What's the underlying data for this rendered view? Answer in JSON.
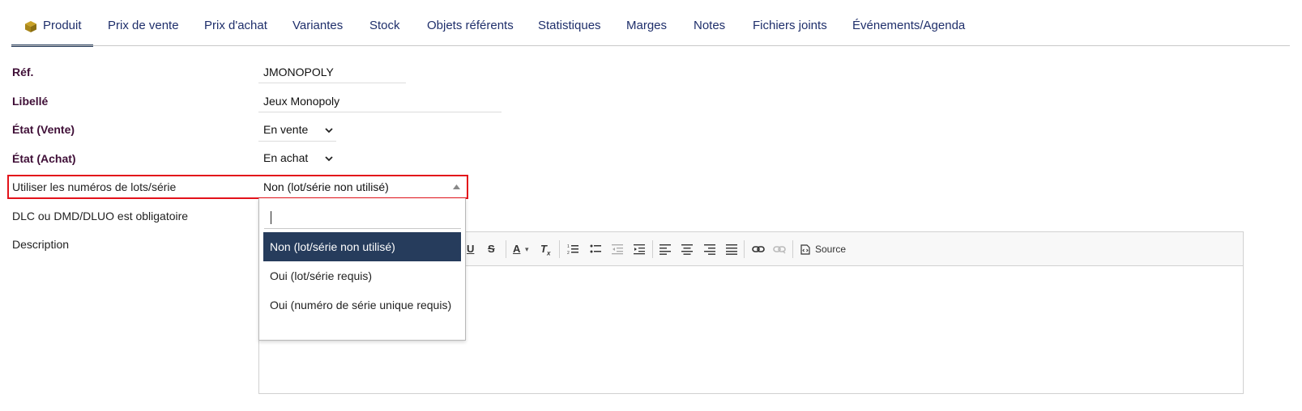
{
  "tabs": [
    {
      "label": "Produit",
      "icon": "box-icon",
      "active": true
    },
    {
      "label": "Prix de vente"
    },
    {
      "label": "Prix d'achat"
    },
    {
      "label": "Variantes"
    },
    {
      "label": "Stock"
    },
    {
      "label": "Objets référents"
    },
    {
      "label": "Statistiques"
    },
    {
      "label": "Marges"
    },
    {
      "label": "Notes"
    },
    {
      "label": "Fichiers joints"
    },
    {
      "label": "Événements/Agenda"
    }
  ],
  "form": {
    "ref_label": "Réf.",
    "ref_value": "JMONOPOLY",
    "libelle_label": "Libellé",
    "libelle_value": "Jeux Monopoly",
    "etat_vente_label": "État (Vente)",
    "etat_vente_value": "En vente",
    "etat_achat_label": "État (Achat)",
    "etat_achat_value": "En achat",
    "lots_label": "Utiliser les numéros de lots/série",
    "lots_value": "Non (lot/série non utilisé)",
    "dlc_label": "DLC ou DMD/DLUO est obligatoire",
    "description_label": "Description"
  },
  "dropdown": {
    "search_value": "",
    "options": [
      {
        "label": "Non (lot/série non utilisé)",
        "selected": true
      },
      {
        "label": "Oui (lot/série requis)"
      },
      {
        "label": "Oui (numéro de série unique requis)"
      }
    ]
  },
  "editor": {
    "source_label": "Source"
  },
  "colors": {
    "accent": "#263c5c",
    "highlight": "#e3121a",
    "required_label": "#3f0f37",
    "tab_text": "#1f2f6b"
  }
}
